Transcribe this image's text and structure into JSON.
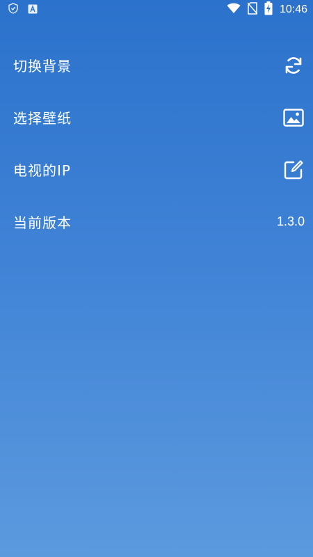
{
  "status_bar": {
    "time": "10:46",
    "notification_icons": [
      "shield-icon",
      "a-icon"
    ],
    "system_icons": [
      "wifi-icon",
      "no-sim-icon",
      "battery-charging-icon"
    ]
  },
  "settings": {
    "items": [
      {
        "label": "切换背景",
        "icon": "refresh-icon"
      },
      {
        "label": "选择壁纸",
        "icon": "image-icon"
      },
      {
        "label": "电视的IP",
        "icon": "edit-icon"
      },
      {
        "label": "当前版本",
        "value": "1.3.0"
      }
    ]
  },
  "colors": {
    "background_top": "#2b72cc",
    "background_bottom": "#5c9ade",
    "text": "#ffffff"
  }
}
